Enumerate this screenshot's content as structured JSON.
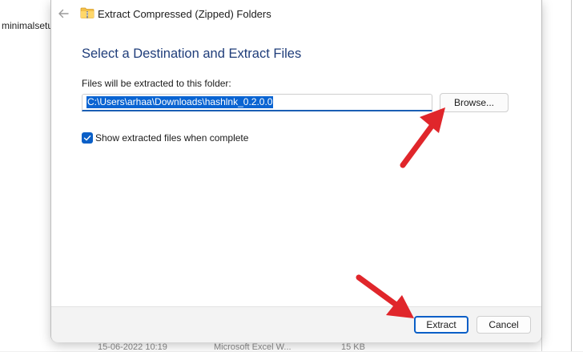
{
  "background": {
    "file_name": "minimalsetu",
    "row_date": "15-06-2022 10:19",
    "row_type": "Microsoft Excel W...",
    "row_size": "15 KB"
  },
  "dialog": {
    "title": "Extract Compressed (Zipped) Folders",
    "heading": "Select a Destination and Extract Files",
    "field_label": "Files will be extracted to this folder:",
    "path_value": "C:\\Users\\arhaa\\Downloads\\hashlnk_0.2.0.0",
    "browse_label": "Browse...",
    "show_files_label": "Show extracted files when complete",
    "show_files_checked": true,
    "extract_label": "Extract",
    "cancel_label": "Cancel"
  },
  "colors": {
    "accent": "#0a5fc7",
    "heading": "#1f3d7a",
    "annotation_arrow": "#e0262b"
  },
  "icons": {
    "back": "back-arrow-icon",
    "zip_folder": "zip-folder-icon",
    "checkmark": "checkmark-icon"
  }
}
